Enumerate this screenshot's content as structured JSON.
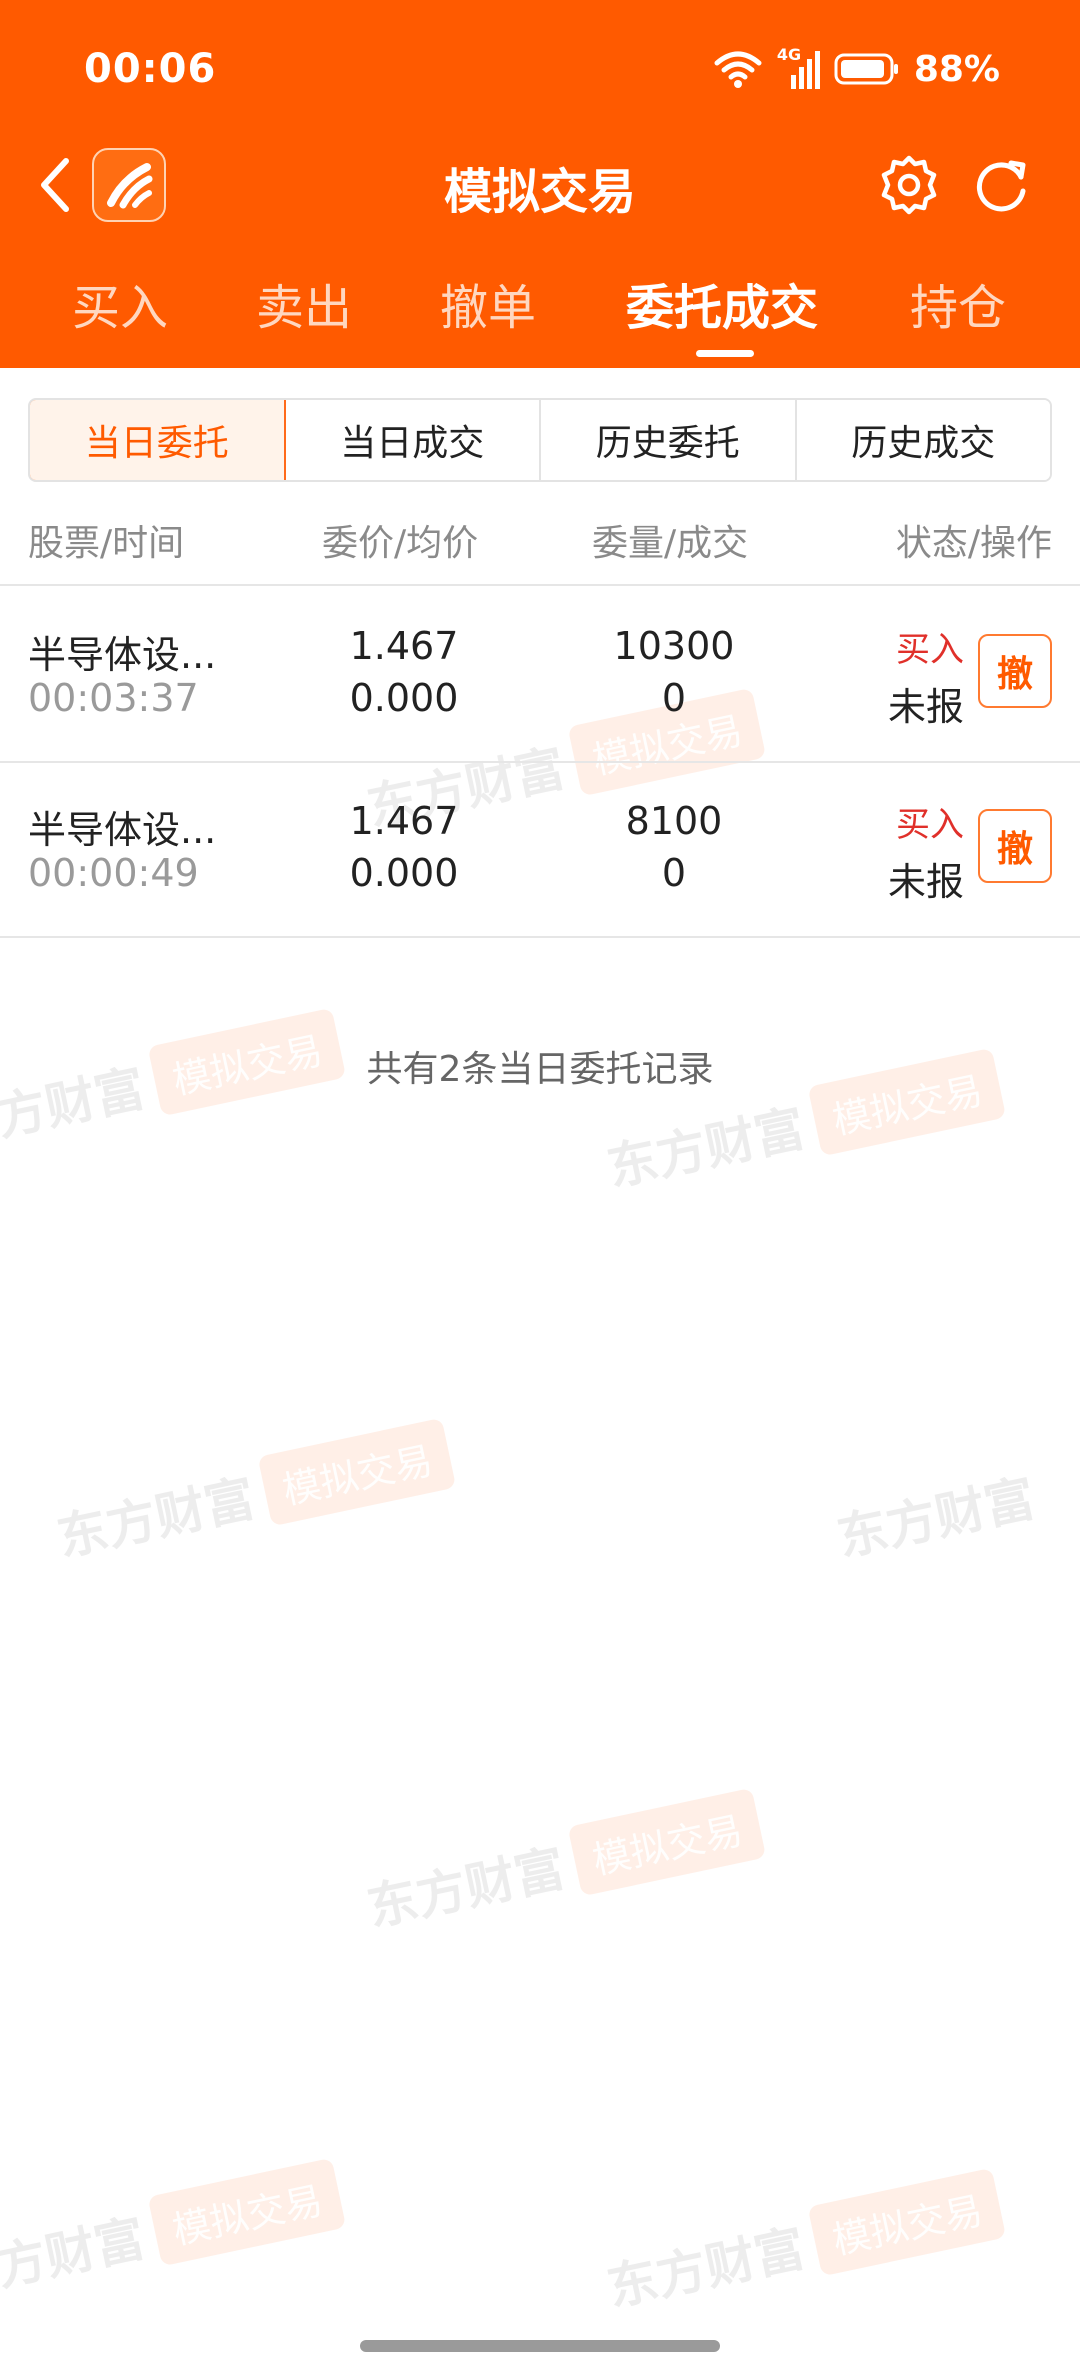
{
  "status_bar": {
    "time": "00:06",
    "network": "4G",
    "battery": "88%"
  },
  "nav": {
    "title": "模拟交易"
  },
  "main_tabs": [
    {
      "label": "买入"
    },
    {
      "label": "卖出"
    },
    {
      "label": "撤单"
    },
    {
      "label": "委托成交"
    },
    {
      "label": "持仓"
    }
  ],
  "active_main_tab": "委托成交",
  "sub_tabs": [
    {
      "label": "当日委托"
    },
    {
      "label": "当日成交"
    },
    {
      "label": "历史委托"
    },
    {
      "label": "历史成交"
    }
  ],
  "table": {
    "headers": [
      "股票/时间",
      "委价/均价",
      "委量/成交",
      "状态/操作"
    ],
    "rows": [
      {
        "name": "半导体设...",
        "time": "00:03:37",
        "price": "1.467",
        "avg_price": "0.000",
        "qty": "10300",
        "filled": "0",
        "side": "买入",
        "status": "未报",
        "action": "撤"
      },
      {
        "name": "半导体设...",
        "time": "00:00:49",
        "price": "1.467",
        "avg_price": "0.000",
        "qty": "8100",
        "filled": "0",
        "side": "买入",
        "status": "未报",
        "action": "撤"
      }
    ]
  },
  "summary": "共有2条当日委托记录",
  "watermark": {
    "brand": "东方财富",
    "tag": "模拟交易"
  },
  "colors": {
    "brand_orange": "#ff5a00",
    "buy_red": "#e0302a"
  }
}
